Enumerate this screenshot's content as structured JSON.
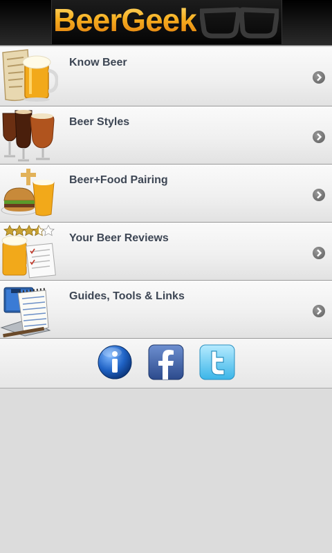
{
  "header": {
    "logo_text": "BeerGeek"
  },
  "menu": {
    "items": [
      {
        "label": "Know Beer",
        "icon": "beer-mug-scroll-icon"
      },
      {
        "label": "Beer Styles",
        "icon": "beer-glasses-icon"
      },
      {
        "label": "Beer+Food Pairing",
        "icon": "burger-beer-icon"
      },
      {
        "label": "Your Beer Reviews",
        "icon": "review-rating-icon",
        "rating_stars": 3.5,
        "rating_max": 5
      },
      {
        "label": "Guides, Tools & Links",
        "icon": "web-notepad-icon"
      }
    ]
  },
  "social": {
    "buttons": [
      {
        "icon": "info-icon"
      },
      {
        "icon": "facebook-icon"
      },
      {
        "icon": "twitter-icon"
      }
    ]
  },
  "colors": {
    "logo_orange": "#f3a81c",
    "label_text": "#3d4654",
    "header_bg": "#000000",
    "page_bg": "#dcdcdc"
  }
}
